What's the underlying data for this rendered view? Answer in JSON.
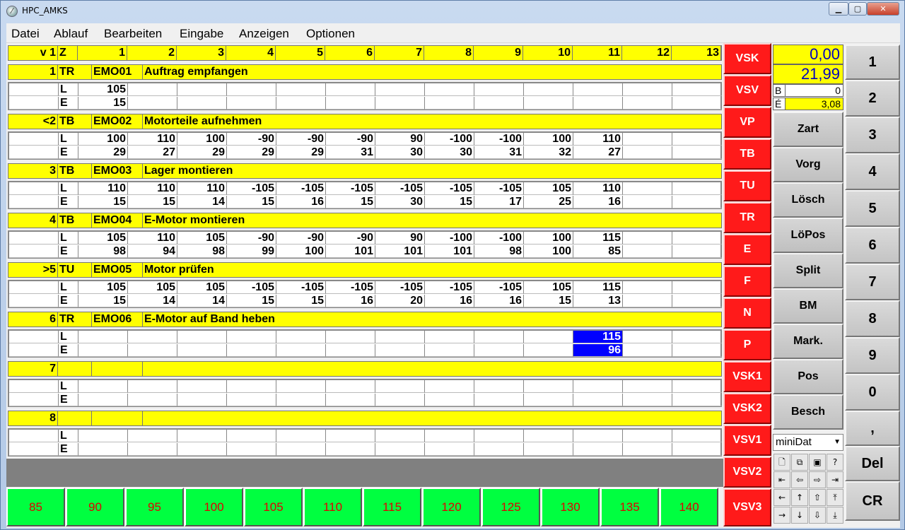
{
  "window": {
    "title": "HPC_AMKS"
  },
  "menu": [
    "Datei",
    "Ablauf",
    "Bearbeiten",
    "Eingabe",
    "Anzeigen",
    "Optionen"
  ],
  "header": {
    "corner": "v 1",
    "z": "Z",
    "columns": [
      "1",
      "2",
      "3",
      "4",
      "5",
      "6",
      "7",
      "8",
      "9",
      "10",
      "11",
      "12",
      "13"
    ]
  },
  "rows": [
    {
      "nr": "1",
      "code": "TR",
      "id": "EMO01",
      "desc": "Auftrag empfangen",
      "L": [
        "105",
        "",
        "",
        "",
        "",
        "",
        "",
        "",
        "",
        "",
        "",
        "",
        ""
      ],
      "E": [
        "15",
        "",
        "",
        "",
        "",
        "",
        "",
        "",
        "",
        "",
        "",
        "",
        ""
      ]
    },
    {
      "nr": "<2",
      "code": "TB",
      "id": "EMO02",
      "desc": "Motorteile aufnehmen",
      "L": [
        "100",
        "110",
        "100",
        "-90",
        "-90",
        "-90",
        "90",
        "-100",
        "-100",
        "100",
        "110",
        "",
        ""
      ],
      "E": [
        "29",
        "27",
        "29",
        "29",
        "29",
        "31",
        "30",
        "30",
        "31",
        "32",
        "27",
        "",
        ""
      ]
    },
    {
      "nr": "3",
      "code": "TB",
      "id": "EMO03",
      "desc": "Lager montieren",
      "L": [
        "110",
        "110",
        "110",
        "-105",
        "-105",
        "-105",
        "-105",
        "-105",
        "-105",
        "105",
        "110",
        "",
        ""
      ],
      "E": [
        "15",
        "15",
        "14",
        "15",
        "16",
        "15",
        "30",
        "15",
        "17",
        "25",
        "16",
        "",
        ""
      ]
    },
    {
      "nr": "4",
      "code": "TB",
      "id": "EMO04",
      "desc": "E-Motor montieren",
      "L": [
        "105",
        "110",
        "105",
        "-90",
        "-90",
        "-90",
        "90",
        "-100",
        "-100",
        "100",
        "115",
        "",
        ""
      ],
      "E": [
        "98",
        "94",
        "98",
        "99",
        "100",
        "101",
        "101",
        "101",
        "98",
        "100",
        "85",
        "",
        ""
      ]
    },
    {
      "nr": ">5",
      "code": "TU",
      "id": "EMO05",
      "desc": "Motor prüfen",
      "L": [
        "105",
        "105",
        "105",
        "-105",
        "-105",
        "-105",
        "-105",
        "-105",
        "-105",
        "105",
        "115",
        "",
        ""
      ],
      "E": [
        "15",
        "14",
        "14",
        "15",
        "15",
        "16",
        "20",
        "16",
        "16",
        "15",
        "13",
        "",
        ""
      ]
    },
    {
      "nr": "6",
      "code": "TR",
      "id": "EMO06",
      "desc": "E-Motor auf Band heben",
      "L": [
        "",
        "",
        "",
        "",
        "",
        "",
        "",
        "",
        "",
        "",
        "115",
        "",
        ""
      ],
      "E": [
        "",
        "",
        "",
        "",
        "",
        "",
        "",
        "",
        "",
        "",
        "96",
        "",
        ""
      ]
    },
    {
      "nr": "7",
      "code": "",
      "id": "",
      "desc": "",
      "L": [
        "",
        "",
        "",
        "",
        "",
        "",
        "",
        "",
        "",
        "",
        "",
        "",
        ""
      ],
      "E": [
        "",
        "",
        "",
        "",
        "",
        "",
        "",
        "",
        "",
        "",
        "",
        "",
        ""
      ]
    },
    {
      "nr": "8",
      "code": "",
      "id": "",
      "desc": "",
      "L": [
        "",
        "",
        "",
        "",
        "",
        "",
        "",
        "",
        "",
        "",
        "",
        "",
        ""
      ],
      "E": [
        "",
        "",
        "",
        "",
        "",
        "",
        "",
        "",
        "",
        "",
        "",
        "",
        ""
      ]
    }
  ],
  "labels": {
    "L": "L",
    "E": "E"
  },
  "bottom_buttons": [
    "85",
    "90",
    "95",
    "100",
    "105",
    "110",
    "115",
    "120",
    "125",
    "130",
    "135",
    "140"
  ],
  "red_buttons": [
    "VSK",
    "VSV",
    "VP",
    "TB",
    "TU",
    "TR",
    "E",
    "F",
    "N",
    "P",
    "VSK1",
    "VSK2",
    "VSV1",
    "VSV2",
    "VSV3"
  ],
  "values": {
    "top": "0,00",
    "second": "21,99",
    "b_label": "B",
    "b_value": "0",
    "e_label": "É",
    "e_value": "3,08"
  },
  "commands": [
    "Zart",
    "Vorg",
    "Lösch",
    "LöPos",
    "Split",
    "BM",
    "Mark.",
    "Pos",
    "Besch"
  ],
  "dropdown": {
    "selected": "miniDat"
  },
  "numpad": [
    "1",
    "2",
    "3",
    "4",
    "5",
    "6",
    "7",
    "8",
    "9",
    "0",
    ",",
    "Del",
    "CR"
  ],
  "colors": {
    "yellow": "#ffff00",
    "red": "#ff1a1a",
    "green": "#00ff40",
    "highlight": "#0000ff"
  }
}
